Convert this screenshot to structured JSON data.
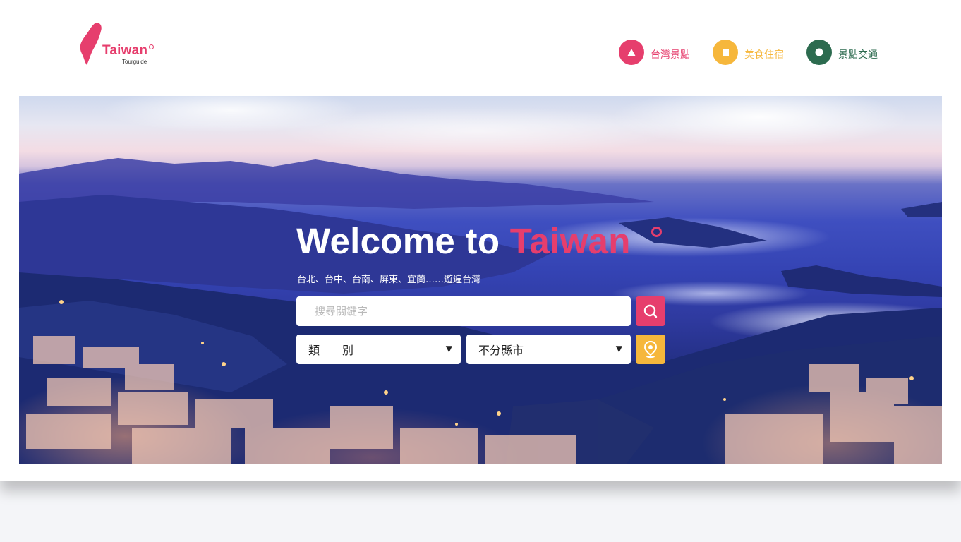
{
  "header": {
    "logo_text": "Taiwan",
    "logo_sub": "Tourguide",
    "nav": [
      {
        "label": "台灣景點",
        "color": "#e63e6d",
        "icon": "triangle-icon"
      },
      {
        "label": "美食住宿",
        "color": "#f6b73c",
        "icon": "square-icon"
      },
      {
        "label": "景點交通",
        "color": "#2c6b4f",
        "icon": "circle-icon"
      }
    ]
  },
  "hero": {
    "title_prefix": "Welcome to",
    "title_accent": "Taiwan",
    "subtitle": "台北、台中、台南、屏東、宜蘭……遊遍台灣",
    "search_placeholder": "搜尋關鍵字",
    "search_icon": "search-icon",
    "category_select": "類　　別",
    "city_select": "不分縣市",
    "location_icon": "map-pin-icon"
  },
  "colors": {
    "accent_pink": "#e63e6d",
    "accent_yellow": "#f6b73c",
    "accent_green": "#2c6b4f"
  }
}
